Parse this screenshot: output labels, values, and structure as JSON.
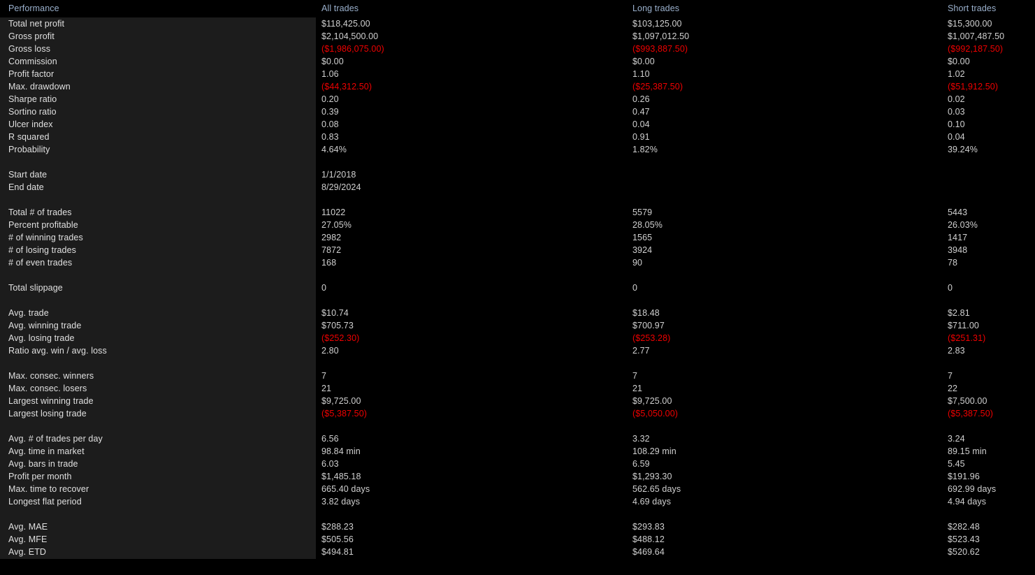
{
  "report": {
    "title": "Performance",
    "columns": [
      "Performance",
      "All trades",
      "Long trades",
      "Short trades"
    ],
    "colors": {
      "background": "#000000",
      "label_panel": "#1c1c1c",
      "header_text": "#9ab0cc",
      "value_text": "#d0d0d0",
      "negative_value": "#ef0000"
    }
  },
  "rows": [
    {
      "label": "Total net profit",
      "all": "$118,425.00",
      "long": "$103,125.00",
      "short": "$15,300.00",
      "neg": false
    },
    {
      "label": "Gross profit",
      "all": "$2,104,500.00",
      "long": "$1,097,012.50",
      "short": "$1,007,487.50",
      "neg": false
    },
    {
      "label": "Gross loss",
      "all": "($1,986,075.00)",
      "long": "($993,887.50)",
      "short": "($992,187.50)",
      "neg": true
    },
    {
      "label": "Commission",
      "all": "$0.00",
      "long": "$0.00",
      "short": "$0.00",
      "neg": false
    },
    {
      "label": "Profit factor",
      "all": "1.06",
      "long": "1.10",
      "short": "1.02",
      "neg": false
    },
    {
      "label": "Max. drawdown",
      "all": "($44,312.50)",
      "long": "($25,387.50)",
      "short": "($51,912.50)",
      "neg": true
    },
    {
      "label": "Sharpe ratio",
      "all": "0.20",
      "long": "0.26",
      "short": "0.02",
      "neg": false
    },
    {
      "label": "Sortino ratio",
      "all": "0.39",
      "long": "0.47",
      "short": "0.03",
      "neg": false
    },
    {
      "label": "Ulcer index",
      "all": "0.08",
      "long": "0.04",
      "short": "0.10",
      "neg": false
    },
    {
      "label": "R squared",
      "all": "0.83",
      "long": "0.91",
      "short": "0.04",
      "neg": false
    },
    {
      "label": "Probability",
      "all": "4.64%",
      "long": "1.82%",
      "short": "39.24%",
      "neg": false
    },
    {
      "spacer": true
    },
    {
      "label": "Start date",
      "all": "1/1/2018",
      "long": "",
      "short": "",
      "neg": false
    },
    {
      "label": "End date",
      "all": "8/29/2024",
      "long": "",
      "short": "",
      "neg": false
    },
    {
      "spacer": true
    },
    {
      "label": "Total # of trades",
      "all": "11022",
      "long": "5579",
      "short": "5443",
      "neg": false
    },
    {
      "label": "Percent profitable",
      "all": "27.05%",
      "long": "28.05%",
      "short": "26.03%",
      "neg": false
    },
    {
      "label": "# of winning trades",
      "all": "2982",
      "long": "1565",
      "short": "1417",
      "neg": false
    },
    {
      "label": "# of losing trades",
      "all": "7872",
      "long": "3924",
      "short": "3948",
      "neg": false
    },
    {
      "label": "# of even trades",
      "all": "168",
      "long": "90",
      "short": "78",
      "neg": false
    },
    {
      "spacer": true
    },
    {
      "label": "Total slippage",
      "all": "0",
      "long": "0",
      "short": "0",
      "neg": false
    },
    {
      "spacer": true
    },
    {
      "label": "Avg. trade",
      "all": "$10.74",
      "long": "$18.48",
      "short": "$2.81",
      "neg": false
    },
    {
      "label": "Avg. winning trade",
      "all": "$705.73",
      "long": "$700.97",
      "short": "$711.00",
      "neg": false
    },
    {
      "label": "Avg. losing trade",
      "all": "($252.30)",
      "long": "($253.28)",
      "short": "($251.31)",
      "neg": true
    },
    {
      "label": "Ratio avg. win / avg. loss",
      "all": "2.80",
      "long": "2.77",
      "short": "2.83",
      "neg": false
    },
    {
      "spacer": true
    },
    {
      "label": "Max. consec. winners",
      "all": "7",
      "long": "7",
      "short": "7",
      "neg": false
    },
    {
      "label": "Max. consec. losers",
      "all": "21",
      "long": "21",
      "short": "22",
      "neg": false
    },
    {
      "label": "Largest winning trade",
      "all": "$9,725.00",
      "long": "$9,725.00",
      "short": "$7,500.00",
      "neg": false
    },
    {
      "label": "Largest losing trade",
      "all": "($5,387.50)",
      "long": "($5,050.00)",
      "short": "($5,387.50)",
      "neg": true
    },
    {
      "spacer": true
    },
    {
      "label": "Avg. # of trades per day",
      "all": "6.56",
      "long": "3.32",
      "short": "3.24",
      "neg": false
    },
    {
      "label": "Avg. time in market",
      "all": "98.84 min",
      "long": "108.29 min",
      "short": "89.15 min",
      "neg": false
    },
    {
      "label": "Avg. bars in trade",
      "all": "6.03",
      "long": "6.59",
      "short": "5.45",
      "neg": false
    },
    {
      "label": "Profit per month",
      "all": "$1,485.18",
      "long": "$1,293.30",
      "short": "$191.96",
      "neg": false
    },
    {
      "label": "Max. time to recover",
      "all": "665.40 days",
      "long": "562.65 days",
      "short": "692.99 days",
      "neg": false
    },
    {
      "label": "Longest flat period",
      "all": "3.82 days",
      "long": "4.69 days",
      "short": "4.94 days",
      "neg": false
    },
    {
      "spacer": true
    },
    {
      "label": "Avg. MAE",
      "all": "$288.23",
      "long": "$293.83",
      "short": "$282.48",
      "neg": false
    },
    {
      "label": "Avg. MFE",
      "all": "$505.56",
      "long": "$488.12",
      "short": "$523.43",
      "neg": false
    },
    {
      "label": "Avg. ETD",
      "all": "$494.81",
      "long": "$469.64",
      "short": "$520.62",
      "neg": false
    }
  ]
}
